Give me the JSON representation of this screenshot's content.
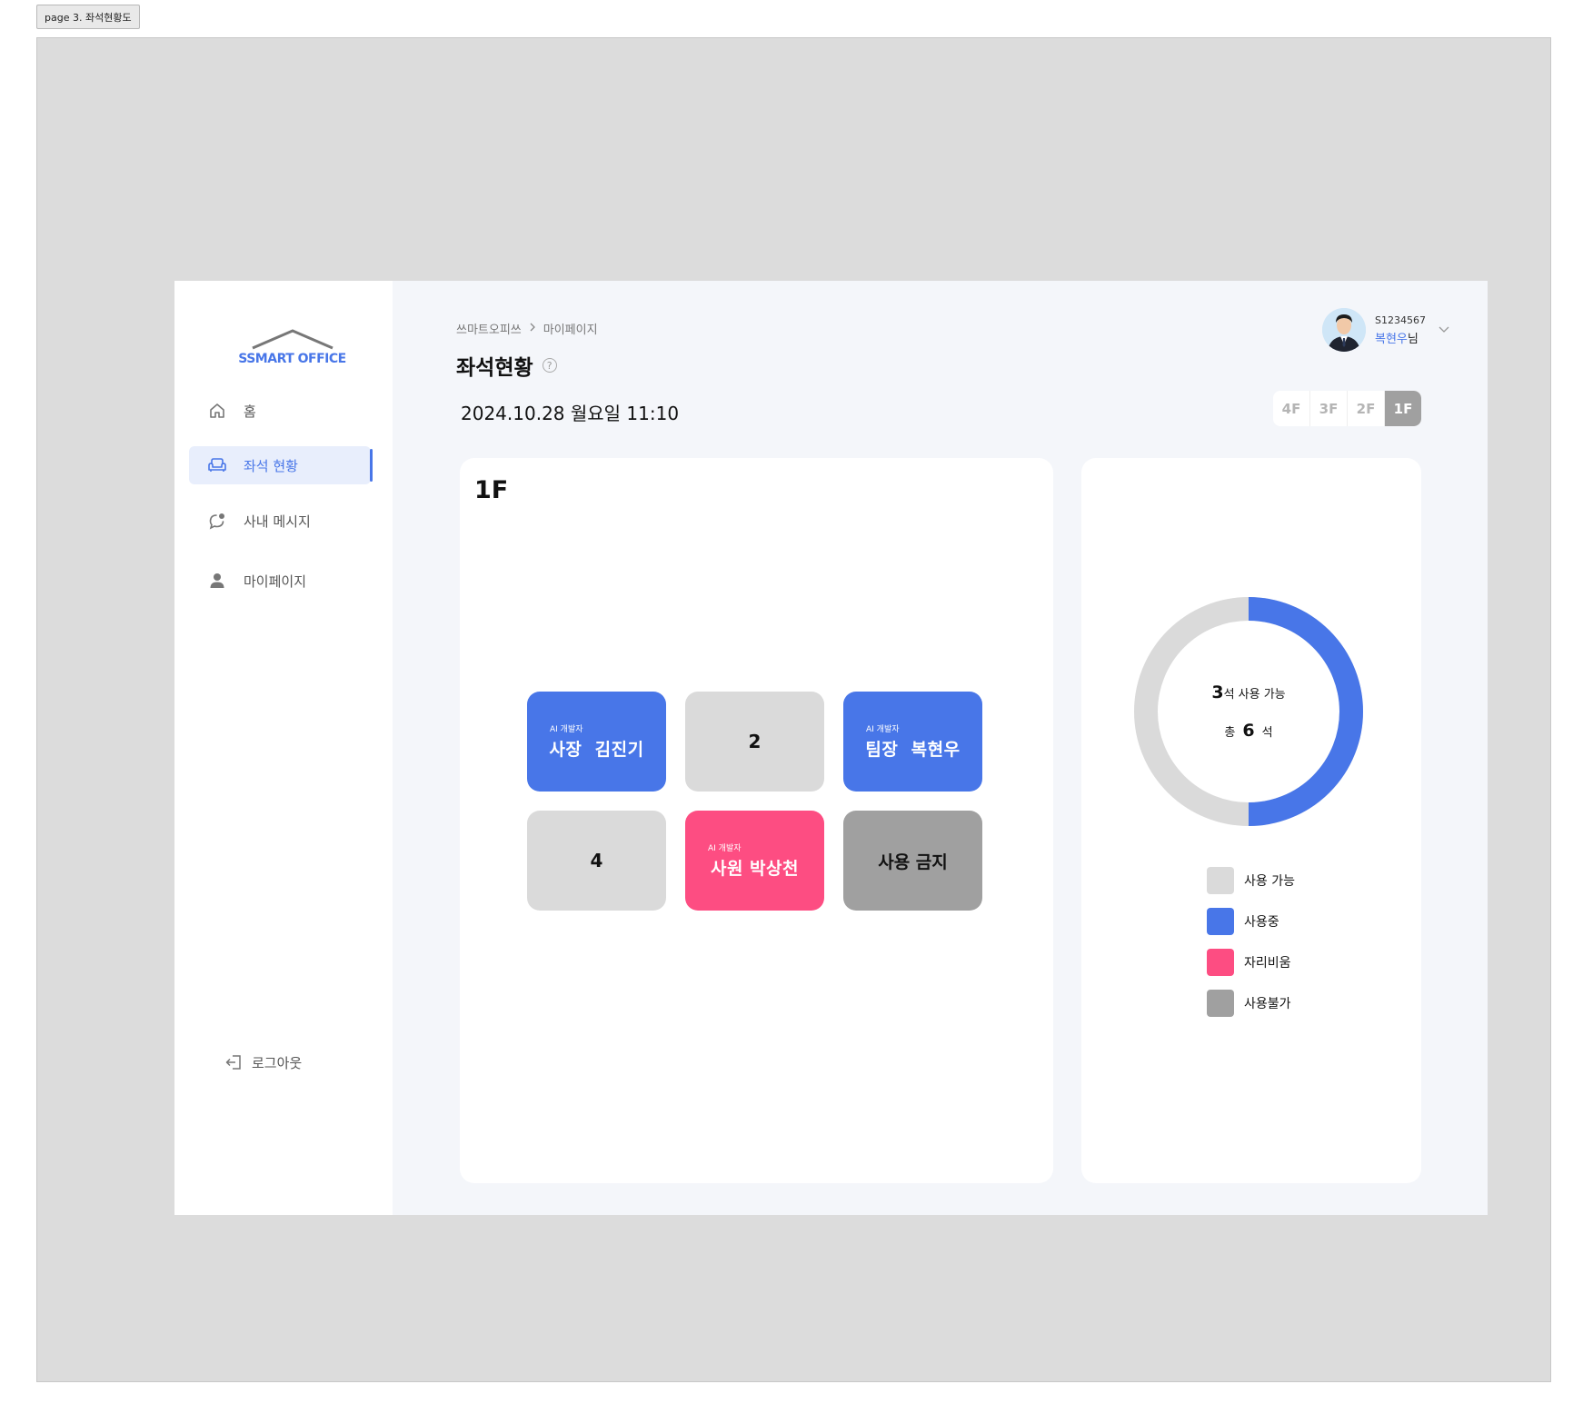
{
  "page_tab": "page 3. 좌석현황도",
  "sidebar": {
    "logo_text": "SSMART OFFICE",
    "items": [
      {
        "label": "홈",
        "icon": "home-icon"
      },
      {
        "label": "좌석 현황",
        "icon": "sofa-icon",
        "active": true
      },
      {
        "label": "사내 메시지",
        "icon": "message-icon"
      },
      {
        "label": "마이페이지",
        "icon": "user-icon"
      }
    ],
    "logout_label": "로그아웃"
  },
  "header": {
    "breadcrumb": [
      "쓰마트오피쓰",
      "마이페이지"
    ],
    "title": "좌석현황",
    "datetime": "2024.10.28 월요일 11:10"
  },
  "user": {
    "id": "S1234567",
    "name": "복현우",
    "suffix": "님"
  },
  "floors": {
    "options": [
      "4F",
      "3F",
      "2F",
      "1F"
    ],
    "selected": "1F"
  },
  "seat_map": {
    "floor_label": "1F",
    "seats": [
      {
        "status": "used",
        "role": "AI 개발자",
        "person": "사장  김진기"
      },
      {
        "status": "available",
        "number": "2"
      },
      {
        "status": "used",
        "role": "AI 개발자",
        "person": "팀장  복현우"
      },
      {
        "status": "available",
        "number": "4"
      },
      {
        "status": "away",
        "role": "AI 개발자",
        "person": "사원 박상천"
      },
      {
        "status": "blocked",
        "label": "사용 금지"
      }
    ]
  },
  "summary": {
    "available_count": "3",
    "available_suffix": "석 사용 가능",
    "total_prefix": "총",
    "total_count": "6",
    "total_suffix": "석",
    "used_fraction": 0.5
  },
  "legend": [
    {
      "label": "사용 가능",
      "color": "#dadada"
    },
    {
      "label": "사용중",
      "color": "#4876e8"
    },
    {
      "label": "자리비움",
      "color": "#fd4d82"
    },
    {
      "label": "사용불가",
      "color": "#a0a0a0"
    }
  ],
  "colors": {
    "accent": "#4876e8",
    "available": "#dadada",
    "away": "#fd4d82",
    "blocked": "#a0a0a0"
  }
}
